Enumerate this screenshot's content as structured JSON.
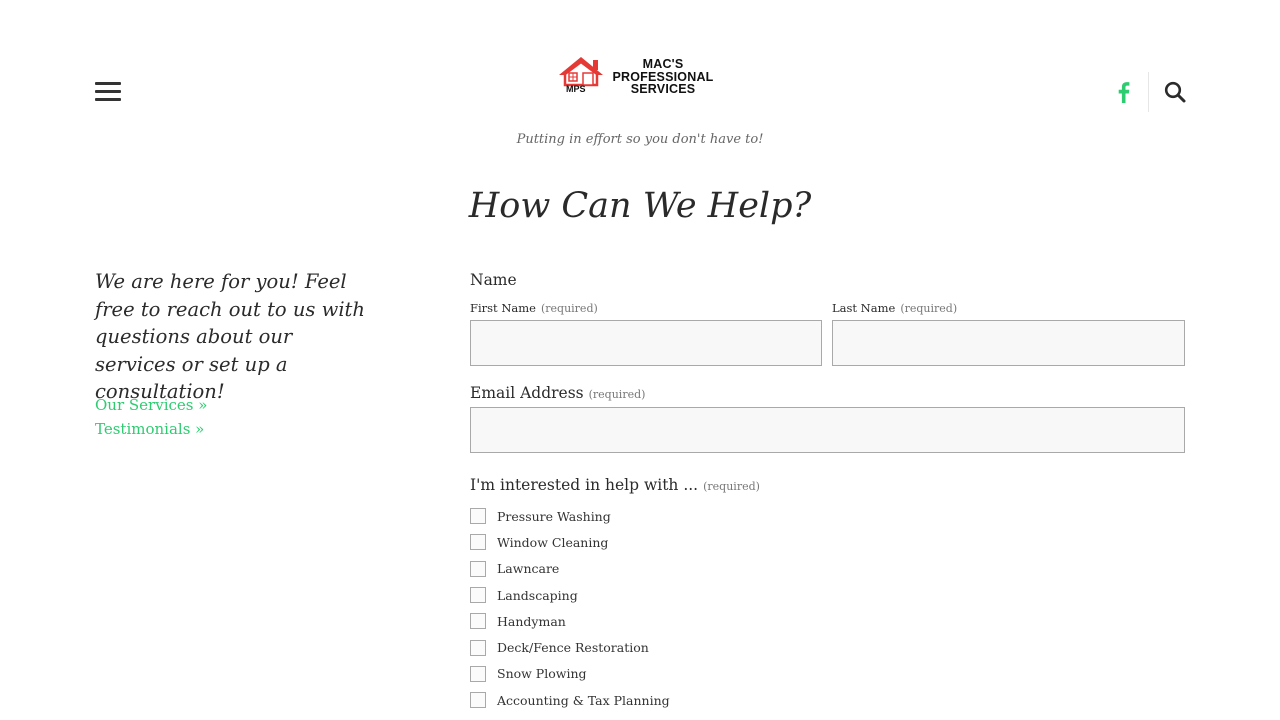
{
  "header": {
    "logo": {
      "line1": "MAC'S",
      "line2": "PROFESSIONAL",
      "line3": "SERVICES",
      "mark_text": "MPS",
      "icon": "house-icon"
    },
    "tagline": "Putting in effort so you don't have to!",
    "icons": {
      "menu": "hamburger-menu-icon",
      "social": "facebook-icon",
      "search": "search-icon"
    }
  },
  "page": {
    "title": "How Can We Help?"
  },
  "sidebar": {
    "intro": "We are here for you! Feel free to reach out to us with questions about our services or set up a consultation!",
    "links": [
      {
        "label": "Our Services »"
      },
      {
        "label": "Testimonials »"
      }
    ]
  },
  "form": {
    "name": {
      "label": "Name",
      "first_label": "First Name",
      "last_label": "Last Name",
      "required_text": "(required)",
      "first_value": "",
      "last_value": ""
    },
    "email": {
      "label": "Email Address",
      "required_text": "(required)",
      "value": ""
    },
    "interest": {
      "label": "I'm interested in help with ...",
      "required_text": "(required)",
      "options": [
        {
          "label": "Pressure Washing",
          "checked": false
        },
        {
          "label": "Window Cleaning",
          "checked": false
        },
        {
          "label": "Lawncare",
          "checked": false
        },
        {
          "label": "Landscaping",
          "checked": false
        },
        {
          "label": "Handyman",
          "checked": false
        },
        {
          "label": "Deck/Fence Restoration",
          "checked": false
        },
        {
          "label": "Snow Plowing",
          "checked": false
        },
        {
          "label": "Accounting & Tax Planning",
          "checked": false
        }
      ]
    }
  },
  "colors": {
    "accent_green": "#2ecc71",
    "logo_red": "#e53935",
    "input_border": "#a9a9a9",
    "input_background": "#f8f8f8"
  }
}
